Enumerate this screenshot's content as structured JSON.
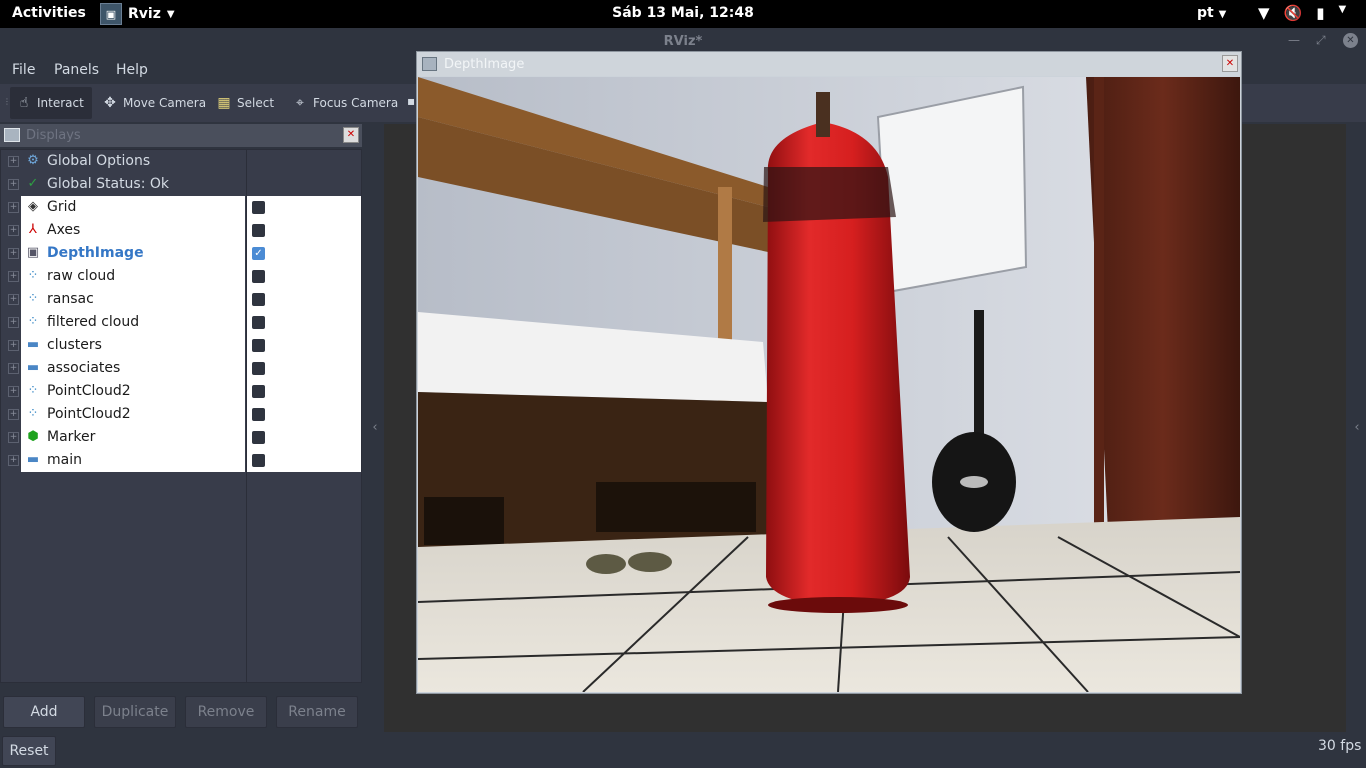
{
  "topbar": {
    "activities": "Activities",
    "app_name": "Rviz",
    "clock": "Sáb 13 Mai, 12:48",
    "lang": "pt",
    "sys_icons": [
      "wifi-icon",
      "volume-muted-icon",
      "battery-icon",
      "power-menu-icon"
    ]
  },
  "window": {
    "title": "RViz*"
  },
  "menu": {
    "file": "File",
    "panels": "Panels",
    "help": "Help"
  },
  "toolbar": {
    "interact": "Interact",
    "move_camera": "Move Camera",
    "select": "Select",
    "focus_camera": "Focus Camera"
  },
  "displays": {
    "title": "Displays",
    "items": [
      {
        "label": "Global Options",
        "icon": "gear-icon"
      },
      {
        "label": "Global Status: Ok",
        "icon": "check-icon"
      },
      {
        "label": "Grid",
        "icon": "grid-icon",
        "checked": false
      },
      {
        "label": "Axes",
        "icon": "axes-icon",
        "checked": false
      },
      {
        "label": "DepthImage",
        "icon": "image-icon",
        "checked": true
      },
      {
        "label": "raw cloud",
        "icon": "pointcloud-icon",
        "checked": false
      },
      {
        "label": "ransac",
        "icon": "pointcloud-icon",
        "checked": false
      },
      {
        "label": "filtered cloud",
        "icon": "pointcloud-icon",
        "checked": false
      },
      {
        "label": "clusters",
        "icon": "folder-icon",
        "checked": false
      },
      {
        "label": "associates",
        "icon": "folder-icon",
        "checked": false
      },
      {
        "label": "PointCloud2",
        "icon": "pointcloud-icon",
        "checked": false
      },
      {
        "label": "PointCloud2",
        "icon": "pointcloud-icon",
        "checked": false
      },
      {
        "label": "Marker",
        "icon": "cube-icon",
        "checked": false
      },
      {
        "label": "main",
        "icon": "folder-icon",
        "checked": false
      }
    ]
  },
  "buttons": {
    "add": "Add",
    "duplicate": "Duplicate",
    "remove": "Remove",
    "rename": "Rename",
    "reset": "Reset"
  },
  "status": {
    "fps": "30 fps"
  },
  "depth_window": {
    "title": "DepthImage"
  },
  "colors": {
    "accent": "#3577c6",
    "checkbox_on": "#4b8bd4",
    "bag_red": "#d61f1f"
  }
}
